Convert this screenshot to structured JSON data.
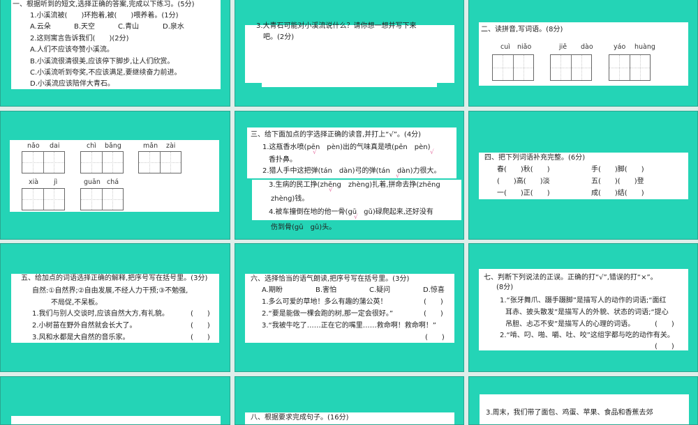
{
  "colors": {
    "slide_bg": "#24d4b6",
    "gap": "#dfeeea",
    "card": "#ffffff",
    "check_mark": "#e77aa8"
  },
  "slide1": {
    "title": "一、根据听到的短文,选择正确的答案,完成以下练习。(5分)",
    "q1": "1.小溪流被(　　)环抱着,被(　　)喂养着。(1分)",
    "q1_options": [
      "A.云朵",
      "B.天空",
      "C.青山",
      "D.泉水"
    ],
    "q2": "2.这则寓言告诉我们(　　)(2分)",
    "q2_options": [
      "A.人们不应该夸赞小溪流。",
      "B.小溪流很清很美,应该停下脚步,让人们欣赏。",
      "C.小溪流听到夸奖,不应该满足,要继续奋力前进。",
      "D.小溪流应该陪伴大青石。"
    ]
  },
  "slide2": {
    "q3_line1": "3.大青石可能对小溪流说什么？请你想一想并写下来",
    "q3_line2": "吧。(2分)"
  },
  "slide3": {
    "title": "二、读拼音,写词语。(8分)",
    "words": [
      [
        "cuì",
        "niǎo"
      ],
      [
        "jiě",
        "dào"
      ],
      [
        "yáo",
        "huàng"
      ]
    ]
  },
  "slide4": {
    "words": [
      [
        "nǎo",
        "dai"
      ],
      [
        "chì",
        "bǎng"
      ],
      [
        "mǎn",
        "zài"
      ],
      [
        "xià",
        "jì"
      ],
      [
        "guān",
        "chá"
      ]
    ]
  },
  "slide5": {
    "title": "三、给下面加点的字选择正确的读音,并打上“√”。(4分)",
    "lines": [
      "1.这瓶香水喷(pēn　pèn)出的气味真是喷(pēn　pèn)",
      "香扑鼻。",
      "2.猎人手中这把弹(tán　dàn)弓的弹(tán　dàn)力很大。",
      "3.生病的民工挣(zhēng　zhèng)扎着,拼命去挣(zhēng",
      "zhèng)钱。",
      "4.被车撞倒在地的他一骨(gū　gǔ)碌爬起来,还好没有",
      "伤到骨(gū　gǔ)头。"
    ],
    "check": "√"
  },
  "slide6": {
    "title": "四、把下列词语补充完整。(6分)",
    "left": [
      "春(　　)秋(　　)",
      "(　　)高(　　)淡",
      "一(　　)正(　　)"
    ],
    "right": [
      "手(　　)脚(　　)",
      "五(　　)(　　)登",
      "成(　　)结(　　)"
    ]
  },
  "slide7": {
    "title": "五、给加点的词语选择正确的解释,把序号写在括号里。(3分)",
    "def1": "自然:①自然界;②自由发展,不经人力干预;③不勉强,",
    "def2": "不局促,不呆板。",
    "items": [
      "1.我们与别人交谈时,应该自然大方,有礼貌。",
      "2.小树苗在野外自然就会长大了。",
      "3.风和水都是大自然的音乐家。"
    ],
    "paren": "(　　)"
  },
  "slide8": {
    "title": "六、选择恰当的语气朗读,把序号写在括号里。(3分)",
    "options": [
      "A.期盼",
      "B.害怕",
      "C.疑问",
      "D.惊喜"
    ],
    "items": [
      "1.多么可爱的草地！多么有趣的蒲公英！",
      "2.“要是能做一棵会跑的树,那一定会很好。”",
      "3.“我被牛吃了……正在它的嘴里……救命啊！救命啊！”"
    ],
    "paren": "(　　)"
  },
  "slide9": {
    "title": "七、判断下列说法的正误。正确的打“√”,错误的打“×”。",
    "score": "(8分)",
    "item1": [
      "1.“张牙舞爪、蹑手蹑脚”是描写人的动作的词语;“面红",
      "耳赤、披头散发”是描写人的外貌、状态的词语;“提心",
      "吊胆、忐忑不安”是描写人的心理的词语。"
    ],
    "item2": "2.“啃、叼、啪、嚼、吐、咬”这组字都与吃的动作有关。",
    "paren": "(　　)"
  },
  "slide11": {
    "title": "八、根据要求完成句子。(16分)"
  },
  "slide12": {
    "line": "3.周末，我们带了面包、鸡蛋、苹果、食品和香蕉去郊"
  }
}
